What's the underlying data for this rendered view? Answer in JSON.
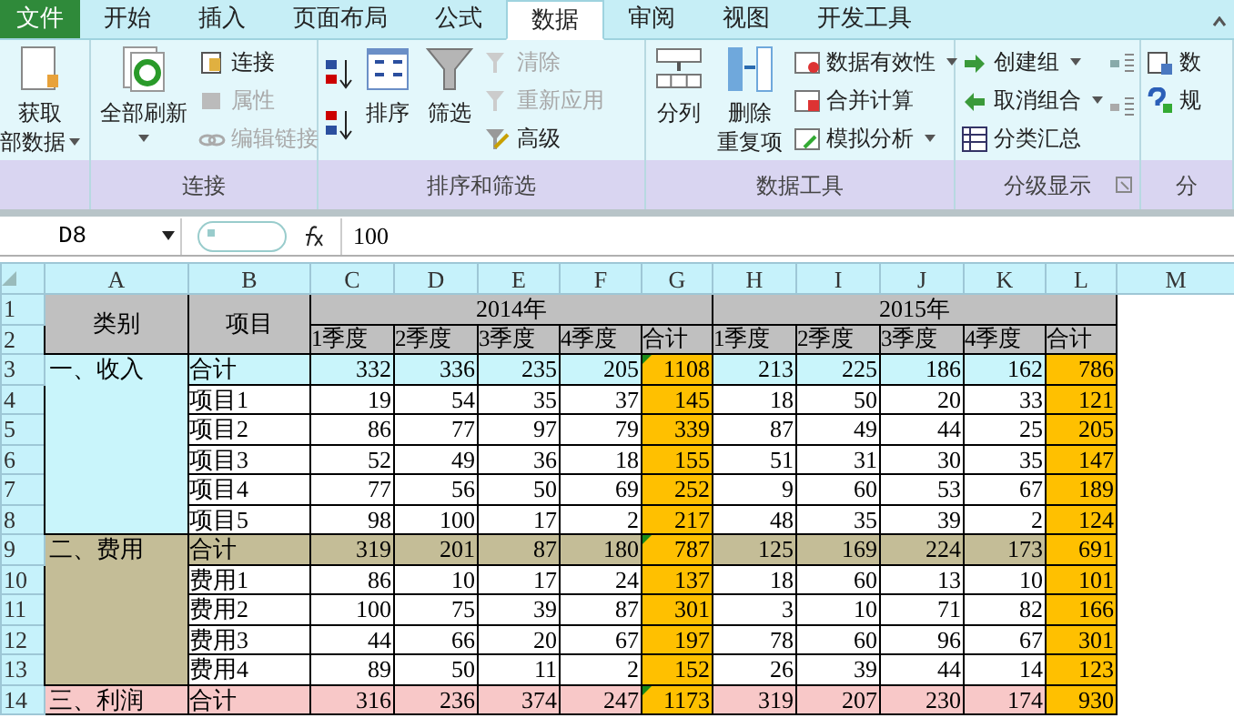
{
  "tabs": [
    {
      "label": "文件",
      "kind": "file",
      "selected": false
    },
    {
      "label": "开始",
      "kind": "tab",
      "selected": false
    },
    {
      "label": "插入",
      "kind": "tab",
      "selected": false
    },
    {
      "label": "页面布局",
      "kind": "tab",
      "selected": false
    },
    {
      "label": "公式",
      "kind": "tab",
      "selected": false
    },
    {
      "label": "数据",
      "kind": "tab",
      "selected": true
    },
    {
      "label": "审阅",
      "kind": "tab",
      "selected": false
    },
    {
      "label": "视图",
      "kind": "tab",
      "selected": false
    },
    {
      "label": "开发工具",
      "kind": "tab",
      "selected": false
    }
  ],
  "ribbon": {
    "groups": [
      {
        "launcher": false,
        "columns": [
          {
            "kind": "large",
            "lines": [
              "获取",
              "部数据"
            ],
            "dropdown": true
          }
        ]
      },
      {
        "label": "连接",
        "launcher": false,
        "columns": [
          {
            "kind": "large",
            "lines": [
              "全部刷新"
            ],
            "dropdown": true
          },
          {
            "kind": "stack",
            "items": [
              {
                "label": "连接",
                "disabled": false,
                "dropdown": false
              },
              {
                "label": "属性",
                "disabled": true,
                "dropdown": false
              },
              {
                "label": "编辑链接",
                "disabled": true,
                "dropdown": false
              }
            ]
          }
        ]
      },
      {
        "label": "排序和筛选",
        "launcher": false,
        "columns": [
          {
            "kind": "sort"
          },
          {
            "kind": "large",
            "lines": [
              "排序"
            ],
            "dropdown": false
          },
          {
            "kind": "large",
            "lines": [
              "筛选"
            ],
            "dropdown": false
          },
          {
            "kind": "stack",
            "items": [
              {
                "label": "清除",
                "disabled": true,
                "dropdown": false
              },
              {
                "label": "重新应用",
                "disabled": true,
                "dropdown": false
              },
              {
                "label": "高级",
                "disabled": false,
                "dropdown": false
              }
            ]
          }
        ]
      },
      {
        "label": "数据工具",
        "launcher": false,
        "columns": [
          {
            "kind": "large",
            "lines": [
              "分列"
            ],
            "dropdown": false
          },
          {
            "kind": "large",
            "lines": [
              "删除",
              "重复项"
            ],
            "dropdown": false
          },
          {
            "kind": "stack",
            "items": [
              {
                "label": "数据有效性",
                "disabled": false,
                "dropdown": true
              },
              {
                "label": "合并计算",
                "disabled": false,
                "dropdown": false
              },
              {
                "label": "模拟分析",
                "disabled": false,
                "dropdown": true
              }
            ]
          }
        ]
      },
      {
        "label": "分级显示",
        "launcher": true,
        "columns": [
          {
            "kind": "stack",
            "items": [
              {
                "label": "创建组",
                "disabled": false,
                "dropdown": true
              },
              {
                "label": "取消组合",
                "disabled": false,
                "dropdown": true
              },
              {
                "label": "分类汇总",
                "disabled": false,
                "dropdown": false
              }
            ]
          },
          {
            "kind": "outline"
          }
        ]
      },
      {
        "label": "分",
        "launcher": false,
        "columns": [
          {
            "kind": "stack",
            "items": [
              {
                "label": "数",
                "disabled": false,
                "dropdown": false
              },
              {
                "label": "规",
                "disabled": false,
                "dropdown": false
              }
            ]
          }
        ]
      }
    ]
  },
  "formula_bar": {
    "name_box": "D8",
    "value": "100"
  },
  "sheet": {
    "columns": [
      "A",
      "B",
      "C",
      "D",
      "E",
      "F",
      "G",
      "H",
      "I",
      "J",
      "K",
      "L",
      "M"
    ],
    "row_numbers": [
      "1",
      "2",
      "3",
      "4",
      "5",
      "6",
      "7",
      "8",
      "9",
      "10",
      "11",
      "12",
      "13",
      "14"
    ],
    "header": {
      "category": "类别",
      "item": "项目",
      "years": [
        {
          "label": "2014年",
          "quarters": [
            "1季度",
            "2季度",
            "3季度",
            "4季度",
            "合计"
          ]
        },
        {
          "label": "2015年",
          "quarters": [
            "1季度",
            "2季度",
            "3季度",
            "4季度",
            "合计"
          ]
        }
      ]
    },
    "sections": [
      {
        "label": "一、收入",
        "color": "#c9f5fb",
        "rows": [
          {
            "item": "合计",
            "kind": "total",
            "values": [
              "332",
              "336",
              "235",
              "205",
              "1108",
              "213",
              "225",
              "186",
              "162",
              "786"
            ]
          },
          {
            "item": "项目1",
            "kind": "detail",
            "values": [
              "19",
              "54",
              "35",
              "37",
              "145",
              "18",
              "50",
              "20",
              "33",
              "121"
            ]
          },
          {
            "item": "项目2",
            "kind": "detail",
            "values": [
              "86",
              "77",
              "97",
              "79",
              "339",
              "87",
              "49",
              "44",
              "25",
              "205"
            ]
          },
          {
            "item": "项目3",
            "kind": "detail",
            "values": [
              "52",
              "49",
              "36",
              "18",
              "155",
              "51",
              "31",
              "30",
              "35",
              "147"
            ]
          },
          {
            "item": "项目4",
            "kind": "detail",
            "values": [
              "77",
              "56",
              "50",
              "69",
              "252",
              "9",
              "60",
              "53",
              "67",
              "189"
            ]
          },
          {
            "item": "项目5",
            "kind": "detail",
            "values": [
              "98",
              "100",
              "17",
              "2",
              "217",
              "48",
              "35",
              "39",
              "2",
              "124"
            ]
          }
        ]
      },
      {
        "label": "二、费用",
        "color": "#c4bd97",
        "rows": [
          {
            "item": "合计",
            "kind": "total",
            "values": [
              "319",
              "201",
              "87",
              "180",
              "787",
              "125",
              "169",
              "224",
              "173",
              "691"
            ]
          },
          {
            "item": "费用1",
            "kind": "detail",
            "values": [
              "86",
              "10",
              "17",
              "24",
              "137",
              "18",
              "60",
              "13",
              "10",
              "101"
            ]
          },
          {
            "item": "费用2",
            "kind": "detail",
            "values": [
              "100",
              "75",
              "39",
              "87",
              "301",
              "3",
              "10",
              "71",
              "82",
              "166"
            ]
          },
          {
            "item": "费用3",
            "kind": "detail",
            "values": [
              "44",
              "66",
              "20",
              "67",
              "197",
              "78",
              "60",
              "96",
              "67",
              "301"
            ]
          },
          {
            "item": "费用4",
            "kind": "detail",
            "values": [
              "89",
              "50",
              "11",
              "2",
              "152",
              "26",
              "39",
              "44",
              "14",
              "123"
            ]
          }
        ]
      },
      {
        "label": "三、利润",
        "color": "#f8c8c8",
        "rows": [
          {
            "item": "合计",
            "kind": "total",
            "values": [
              "316",
              "236",
              "374",
              "247",
              "1173",
              "319",
              "207",
              "230",
              "174",
              "930"
            ]
          }
        ]
      }
    ]
  }
}
